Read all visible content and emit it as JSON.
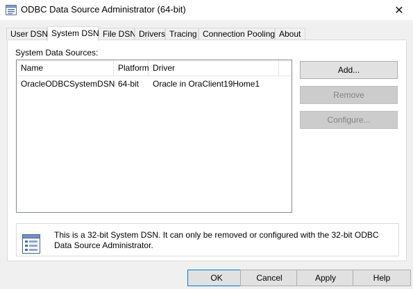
{
  "window": {
    "title": "ODBC Data Source Administrator (64-bit)",
    "close_glyph": "✕"
  },
  "tabs": [
    {
      "label": "User DSN"
    },
    {
      "label": "System DSN",
      "active": true
    },
    {
      "label": "File DSN"
    },
    {
      "label": "Drivers"
    },
    {
      "label": "Tracing"
    },
    {
      "label": "Connection Pooling"
    },
    {
      "label": "About"
    }
  ],
  "panel": {
    "section_label": "System Data Sources:",
    "columns": [
      "Name",
      "Platform",
      "Driver"
    ],
    "rows": [
      {
        "name": "OracleODBCSystemDSN",
        "platform": "64-bit",
        "driver": "Oracle in OraClient19Home1"
      }
    ],
    "buttons": {
      "add": "Add...",
      "remove": "Remove",
      "configure": "Configure..."
    },
    "info_text": "This is a 32-bit System DSN. It can only be removed or configured with the 32-bit ODBC Data Source Administrator."
  },
  "footer": {
    "ok": "OK",
    "cancel": "Cancel",
    "apply": "Apply",
    "help": "Help"
  },
  "icons": {
    "title": "odbc-datasource-icon",
    "info": "datasource-list-icon"
  }
}
